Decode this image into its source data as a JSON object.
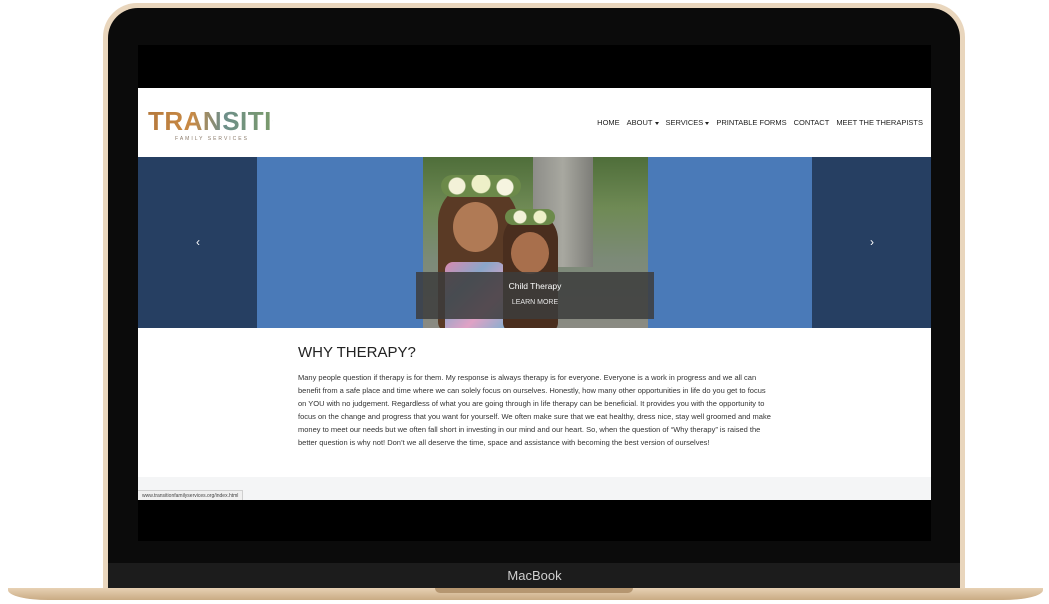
{
  "device": {
    "label": "MacBook"
  },
  "site": {
    "logo": {
      "word": "TRANSITION",
      "tagline": "FAMILY SERVICES"
    },
    "nav": [
      {
        "label": "HOME",
        "dropdown": false
      },
      {
        "label": "ABOUT",
        "dropdown": true
      },
      {
        "label": "SERVICES",
        "dropdown": true
      },
      {
        "label": "PRINTABLE FORMS",
        "dropdown": false
      },
      {
        "label": "CONTACT",
        "dropdown": false
      },
      {
        "label": "MEET THE THERAPISTS",
        "dropdown": false
      }
    ],
    "slider": {
      "prev_icon": "chevron-left-icon",
      "next_icon": "chevron-right-icon",
      "prev_glyph": "‹",
      "next_glyph": "›",
      "caption_title": "Child Therapy",
      "caption_link": "LEARN MORE"
    },
    "content": {
      "heading": "WHY THERAPY?",
      "body": "Many people question if therapy is for them. My response is always therapy is for everyone. Everyone is a work in progress and we all can benefit from a safe place and time where we can solely focus on ourselves. Honestly, how many other opportunities in life do you get to focus on YOU with no judgement. Regardless of what you are going through in life therapy can be beneficial. It provides you with the opportunity to focus on the change and progress that you want for yourself. We often make sure that we eat healthy, dress nice, stay well groomed and make money to meet our needs but we often fall short in investing in our mind and our heart. So, when the question of “Why therapy” is raised the better question is why not! Don’t we all deserve the time, space and assistance with becoming the best version of ourselves!"
    },
    "status_url": "www.transitionfamilyservices.org/index.html"
  },
  "colors": {
    "slider_blue": "#4a7ab8",
    "slider_dark": "#263f62",
    "frame_gold": "#e9d6bd"
  }
}
